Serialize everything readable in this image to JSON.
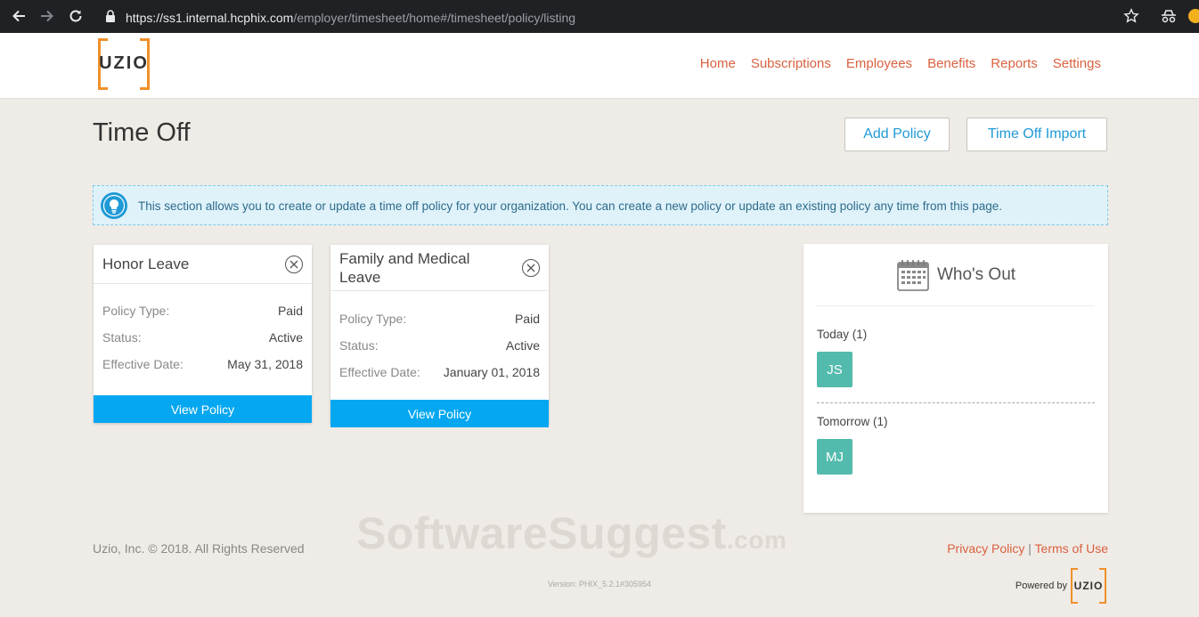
{
  "browser": {
    "url_host": "https://ss1.internal.hcphix.com",
    "url_path": "/employer/timesheet/home#/timesheet/policy/listing"
  },
  "header": {
    "logo_text": "UZIO",
    "nav": [
      "Home",
      "Subscriptions",
      "Employees",
      "Benefits",
      "Reports",
      "Settings"
    ]
  },
  "page": {
    "title": "Time Off",
    "add_policy_label": "Add Policy",
    "import_label": "Time Off Import"
  },
  "info": {
    "text": "This section allows you to create or update a time off policy for your organization. You can create a new policy or update an existing policy any time from this page."
  },
  "policies": [
    {
      "title": "Honor Leave",
      "type_label": "Policy Type:",
      "type": "Paid",
      "status_label": "Status:",
      "status": "Active",
      "date_label": "Effective Date:",
      "date": "May 31, 2018",
      "view_label": "View Policy"
    },
    {
      "title": "Family and Medical Leave",
      "type_label": "Policy Type:",
      "type": "Paid",
      "status_label": "Status:",
      "status": "Active",
      "date_label": "Effective Date:",
      "date": "January 01, 2018",
      "view_label": "View Policy"
    }
  ],
  "whos_out": {
    "title": "Who's Out",
    "today_label": "Today (1)",
    "today_initials": "JS",
    "tomorrow_label": "Tomorrow (1)",
    "tomorrow_initials": "MJ"
  },
  "watermark": {
    "main": "SoftwareSuggest",
    "suffix": ".com"
  },
  "footer": {
    "copyright": "Uzio, Inc. © 2018. All Rights Reserved",
    "privacy": "Privacy Policy",
    "separator": "|",
    "terms": "Terms of Use",
    "version": "Version: PHIX_5.2.1#305954",
    "powered_by": "Powered by",
    "logo_text": "UZIO"
  },
  "colors": {
    "accent_orange": "#f0902a",
    "nav_link": "#d9613f",
    "primary_blue": "#04a7f0",
    "avatar_teal": "#53bbad"
  }
}
